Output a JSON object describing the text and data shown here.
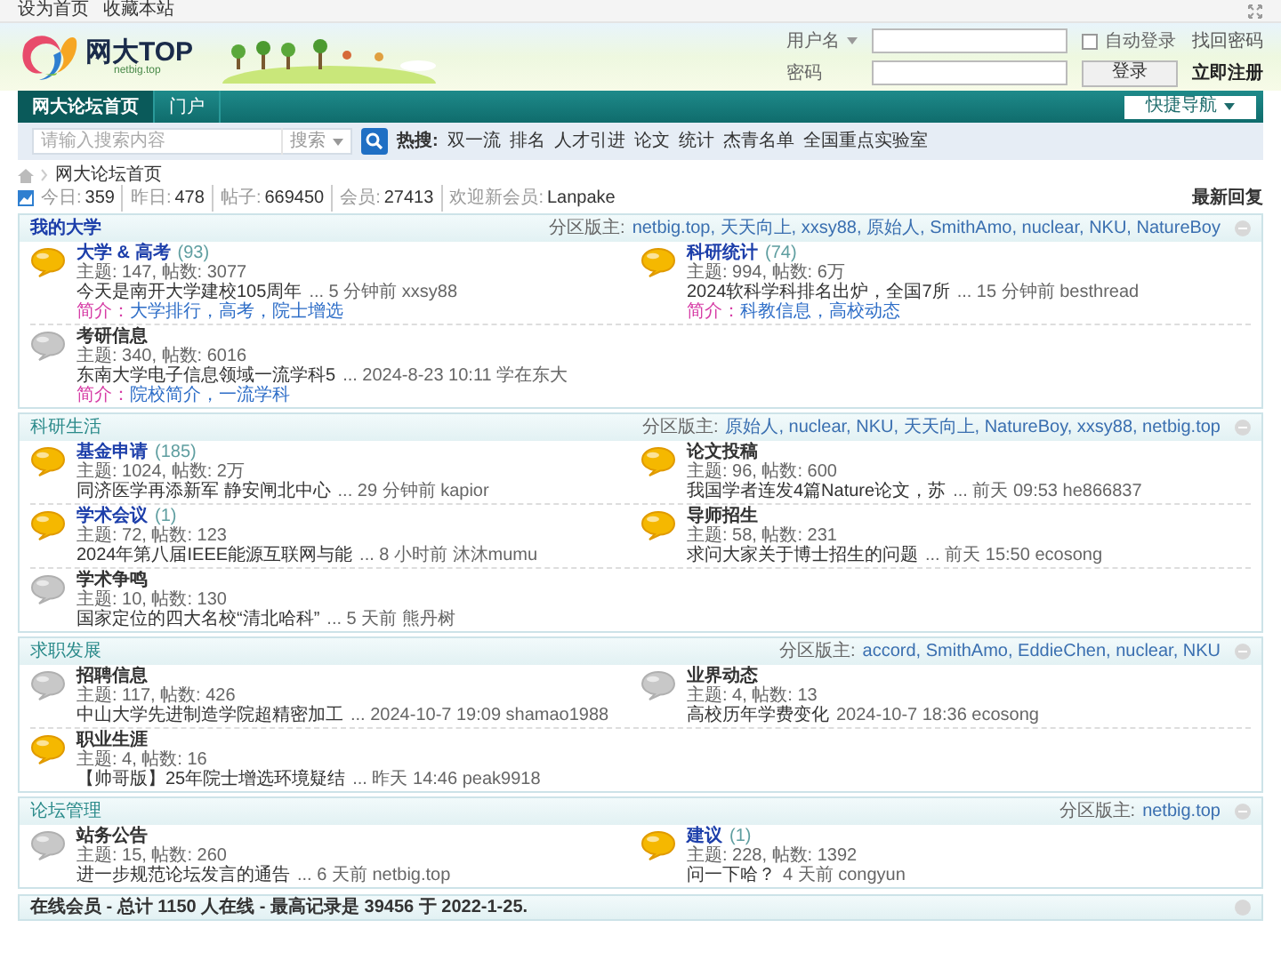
{
  "top_links": [
    "设为首页",
    "收藏本站"
  ],
  "header": {
    "logo_text": "网大TOP",
    "logo_sub": "netbig.top",
    "username_label": "用户名",
    "password_label": "密码",
    "auto_login": {
      "label": "自动登录",
      "checked": false
    },
    "find_password": "找回密码",
    "login_button": "登录",
    "register": "立即注册"
  },
  "nav": {
    "tabs": [
      {
        "label": "网大论坛首页",
        "selected": true
      },
      {
        "label": "门户",
        "selected": false
      }
    ],
    "quick_nav": "快捷导航"
  },
  "search": {
    "placeholder": "请输入搜索内容",
    "type": "搜索",
    "hot_label": "热搜:",
    "hot": [
      "双一流",
      "排名",
      "人才引进",
      "论文",
      "统计",
      "杰青名单",
      "全国重点实验室"
    ]
  },
  "breadcrumb": "网大论坛首页",
  "stats": {
    "items": [
      {
        "label": "今日:",
        "value": "359"
      },
      {
        "label": "昨日:",
        "value": "478"
      },
      {
        "label": "帖子:",
        "value": "669450"
      },
      {
        "label": "会员:",
        "value": "27413"
      },
      {
        "label": "欢迎新会员:",
        "value": "Lanpake"
      }
    ],
    "latest": "最新回复"
  },
  "sections": [
    {
      "title": "我的大学",
      "moderators_label": "分区版主:",
      "moderators": "netbig.top, 天天向上, xxsy88, 原始人, SmithAmo, nuclear, NKU, NatureBoy",
      "forums": [
        {
          "name": "大学 & 高考",
          "new_count": "(93)",
          "has_new": true,
          "stats": "主题: 147, 帖数: 3077",
          "last_post": "今天是南开大学建校105周年",
          "last_meta": "... 5 分钟前 xxsy88",
          "intro_label": "简介：",
          "intro": "大学排行，高考，院士增选"
        },
        {
          "name": "科研统计",
          "new_count": "(74)",
          "has_new": true,
          "stats": "主题: 994, 帖数: 6万",
          "last_post": "2024软科学科排名出炉，全国7所",
          "last_meta": "... 15 分钟前 besthread",
          "intro_label": "简介：",
          "intro": "科教信息，高校动态"
        },
        {
          "name": "考研信息",
          "has_new": false,
          "stats": "主题: 340, 帖数: 6016",
          "last_post": "东南大学电子信息领域一流学科5",
          "last_meta": "... 2024-8-23 10:11 学在东大",
          "intro_label": "简介：",
          "intro": "院校简介，一流学科"
        }
      ]
    },
    {
      "title": "科研生活",
      "moderators_label": "分区版主:",
      "moderators": "原始人, nuclear, NKU, 天天向上, NatureBoy, xxsy88, netbig.top",
      "forums": [
        {
          "name": "基金申请",
          "new_count": "(185)",
          "has_new": true,
          "stats": "主题: 1024, 帖数: 2万",
          "last_post": "同济医学再添新军 静安闸北中心",
          "last_meta": "... 29 分钟前 kapior"
        },
        {
          "name": "论文投稿",
          "has_new": true,
          "stats": "主题: 96, 帖数: 600",
          "last_post": "我国学者连发4篇Nature论文，苏",
          "last_meta": "... 前天 09:53 he866837"
        },
        {
          "name": "学术会议",
          "new_count": "(1)",
          "has_new": true,
          "stats": "主题: 72, 帖数: 123",
          "last_post": "2024年第八届IEEE能源互联网与能",
          "last_meta": "... 8 小时前 沐沐mumu"
        },
        {
          "name": "导师招生",
          "has_new": true,
          "stats": "主题: 58, 帖数: 231",
          "last_post": "求问大家关于博士招生的问题",
          "last_meta": "... 前天 15:50 ecosong"
        },
        {
          "name": "学术争鸣",
          "has_new": false,
          "stats": "主题: 10, 帖数: 130",
          "last_post": "国家定位的四大名校“清北哈科”",
          "last_meta": "... 5 天前 熊丹树"
        }
      ]
    },
    {
      "title": "求职发展",
      "moderators_label": "分区版主:",
      "moderators": "accord, SmithAmo, EddieChen, nuclear, NKU",
      "forums": [
        {
          "name": "招聘信息",
          "has_new": false,
          "stats": "主题: 117, 帖数: 426",
          "last_post": "中山大学先进制造学院超精密加工",
          "last_meta": "... 2024-10-7 19:09 shamao1988"
        },
        {
          "name": "业界动态",
          "has_new": false,
          "stats": "主题: 4, 帖数: 13",
          "last_post": "高校历年学费变化",
          "last_meta": "2024-10-7 18:36 ecosong"
        },
        {
          "name": "职业生涯",
          "has_new": true,
          "stats": "主题: 4, 帖数: 16",
          "last_post": "【帅哥版】25年院士增选环境疑结",
          "last_meta": "... 昨天 14:46 peak9918"
        }
      ]
    },
    {
      "title": "论坛管理",
      "moderators_label": "分区版主:",
      "moderators": "netbig.top",
      "forums": [
        {
          "name": "站务公告",
          "has_new": false,
          "stats": "主题: 15, 帖数: 260",
          "last_post": "进一步规范论坛发言的通告",
          "last_meta": "... 6 天前 netbig.top"
        },
        {
          "name": "建议",
          "new_count": "(1)",
          "has_new": true,
          "stats": "主题: 228, 帖数: 1392",
          "last_post": "问一下哈？",
          "last_meta": "4 天前 congyun"
        }
      ]
    }
  ],
  "online": "在线会员 - 总计 1150 人在线 - 最高记录是 39456 于 2022-1-25."
}
